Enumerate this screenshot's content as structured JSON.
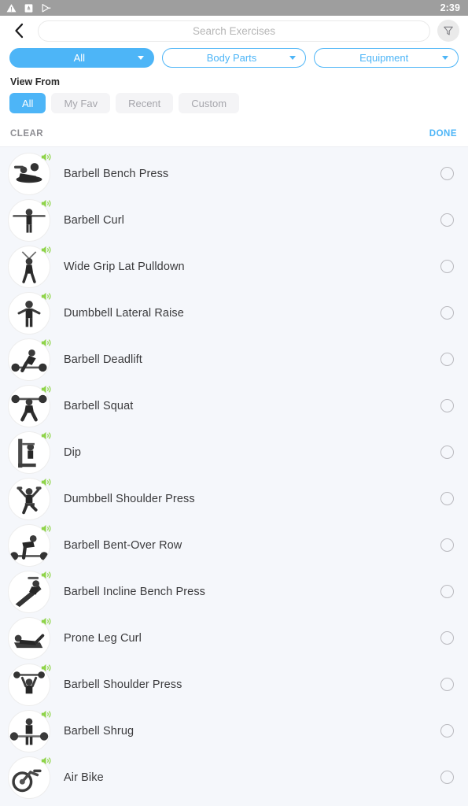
{
  "statusbar": {
    "time": "2:39",
    "icons": [
      "warning-triangle-icon",
      "sim-card-icon",
      "send-arrow-icon"
    ]
  },
  "header": {
    "back_icon": "back-chevron-icon",
    "search": {
      "placeholder": "Search Exercises",
      "value": ""
    },
    "filter_icon": "funnel-filter-icon"
  },
  "filters": {
    "dropdowns": [
      {
        "label": "All",
        "active": true
      },
      {
        "label": "Body Parts",
        "active": false
      },
      {
        "label": "Equipment",
        "active": false
      }
    ]
  },
  "view_from": {
    "title": "View From",
    "options": [
      {
        "label": "All",
        "active": true
      },
      {
        "label": "My Fav",
        "active": false
      },
      {
        "label": "Recent",
        "active": false
      },
      {
        "label": "Custom",
        "active": false
      }
    ]
  },
  "actions": {
    "clear_label": "CLEAR",
    "done_label": "DONE"
  },
  "exercises": [
    {
      "name": "Barbell Bench Press",
      "selected": false,
      "sound_icon": "speaker-icon",
      "pose": "bench"
    },
    {
      "name": "Barbell Curl",
      "selected": false,
      "sound_icon": "speaker-icon",
      "pose": "standing-bar"
    },
    {
      "name": "Wide Grip Lat Pulldown",
      "selected": false,
      "sound_icon": "speaker-icon",
      "pose": "pulldown"
    },
    {
      "name": "Dumbbell Lateral Raise",
      "selected": false,
      "sound_icon": "speaker-icon",
      "pose": "standing"
    },
    {
      "name": "Barbell Deadlift",
      "selected": false,
      "sound_icon": "speaker-icon",
      "pose": "deadlift"
    },
    {
      "name": "Barbell Squat",
      "selected": false,
      "sound_icon": "speaker-icon",
      "pose": "squat"
    },
    {
      "name": "Dip",
      "selected": false,
      "sound_icon": "speaker-icon",
      "pose": "machine"
    },
    {
      "name": "Dumbbell Shoulder Press",
      "selected": false,
      "sound_icon": "speaker-icon",
      "pose": "seated-press"
    },
    {
      "name": "Barbell Bent-Over Row",
      "selected": false,
      "sound_icon": "speaker-icon",
      "pose": "bentover"
    },
    {
      "name": "Barbell Incline Bench Press",
      "selected": false,
      "sound_icon": "speaker-icon",
      "pose": "incline"
    },
    {
      "name": "Prone Leg Curl",
      "selected": false,
      "sound_icon": "speaker-icon",
      "pose": "prone"
    },
    {
      "name": "Barbell Shoulder Press",
      "selected": false,
      "sound_icon": "speaker-icon",
      "pose": "overhead"
    },
    {
      "name": "Barbell Shrug",
      "selected": false,
      "sound_icon": "speaker-icon",
      "pose": "shrug"
    },
    {
      "name": "Air Bike",
      "selected": false,
      "sound_icon": "speaker-icon",
      "pose": "bike"
    }
  ],
  "colors": {
    "accent": "#4db5f7",
    "sound": "#7ed321",
    "page_bg": "#f5f7fb",
    "statusbar_bg": "#9e9e9e"
  }
}
